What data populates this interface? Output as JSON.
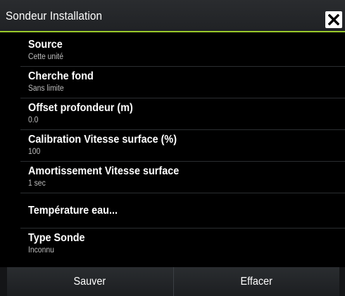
{
  "dialog": {
    "title": "Sondeur Installation"
  },
  "items": [
    {
      "label": "Source",
      "value": "Cette unité"
    },
    {
      "label": "Cherche fond",
      "value": "Sans limite"
    },
    {
      "label": "Offset profondeur (m)",
      "value": "0.0"
    },
    {
      "label": "Calibration Vitesse surface (%)",
      "value": "100"
    },
    {
      "label": "Amortissement Vitesse surface",
      "value": "1 sec"
    },
    {
      "label": "Température eau..."
    },
    {
      "label": "Type Sonde",
      "value": "Inconnu"
    }
  ],
  "footer": {
    "save_label": "Sauver",
    "clear_label": "Effacer"
  },
  "colors": {
    "accent": "#9acb2a",
    "background": "#000000",
    "titlebar": "#25272a"
  }
}
